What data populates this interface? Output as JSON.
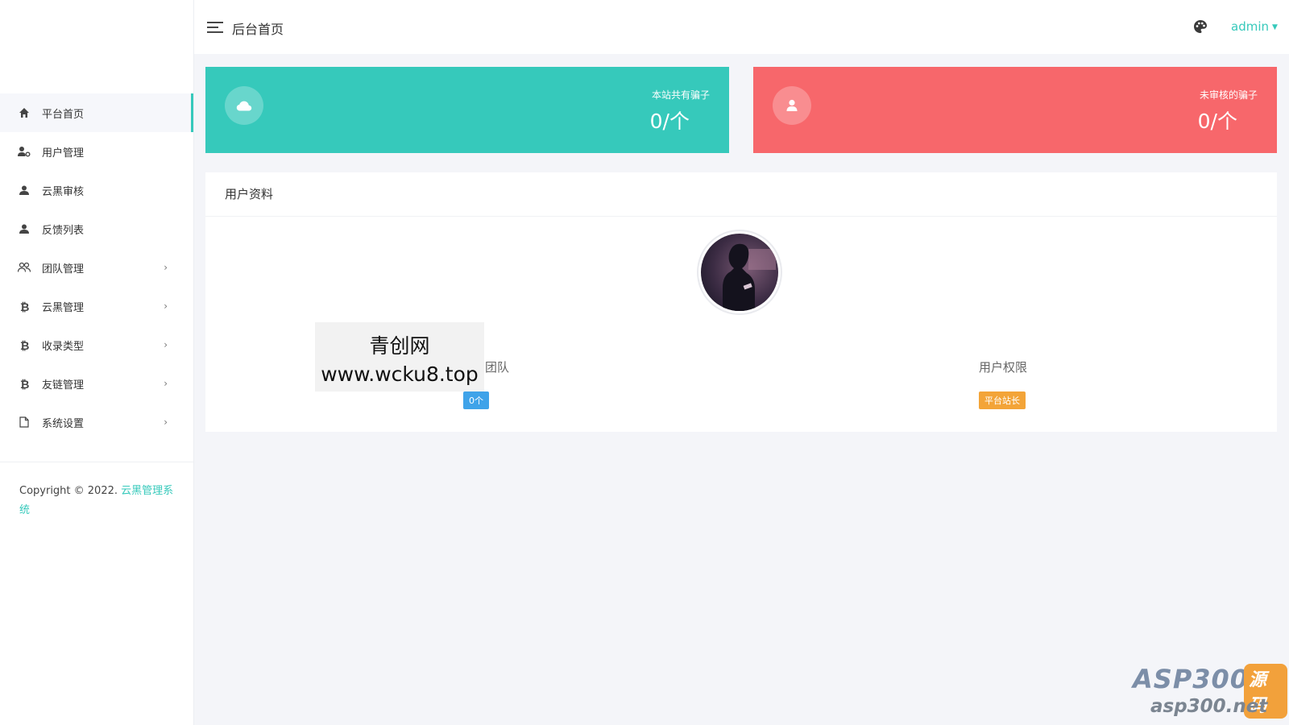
{
  "sidebar": {
    "items": [
      {
        "label": "平台首页",
        "icon": "home-icon",
        "active": true,
        "has_submenu": false
      },
      {
        "label": "用户管理",
        "icon": "user-settings-icon",
        "active": false,
        "has_submenu": false
      },
      {
        "label": "云黑审核",
        "icon": "user-icon",
        "active": false,
        "has_submenu": false
      },
      {
        "label": "反馈列表",
        "icon": "user-icon",
        "active": false,
        "has_submenu": false
      },
      {
        "label": "团队管理",
        "icon": "team-icon",
        "active": false,
        "has_submenu": true
      },
      {
        "label": "云黑管理",
        "icon": "bitcoin-icon",
        "active": false,
        "has_submenu": true
      },
      {
        "label": "收录类型",
        "icon": "bitcoin-icon",
        "active": false,
        "has_submenu": true
      },
      {
        "label": "友链管理",
        "icon": "bitcoin-icon",
        "active": false,
        "has_submenu": true
      },
      {
        "label": "系统设置",
        "icon": "file-icon",
        "active": false,
        "has_submenu": true
      }
    ],
    "submenu_arrow": "›",
    "copyright_prefix": "Copyright © 2022.",
    "copyright_link": "云黑管理系统"
  },
  "header": {
    "title": "后台首页",
    "user": "admin"
  },
  "stats": [
    {
      "label": "本站共有骗子",
      "value": "0/个",
      "color": "#36c9bb",
      "icon": "cloud-icon"
    },
    {
      "label": "未审核的骗子",
      "value": "0/个",
      "color": "#f7676b",
      "icon": "user-icon"
    }
  ],
  "profile": {
    "title": "用户资料",
    "team_label": "团队",
    "team_badge": "0个",
    "permission_label": "用户权限",
    "permission_badge": "平台站长"
  },
  "overlay": {
    "line1": "青创网",
    "line2": "www.wcku8.top"
  },
  "watermark": {
    "brand": "ASP300",
    "badge": "源码",
    "domain": "asp300.net"
  },
  "colors": {
    "accent": "#36c9bb",
    "danger": "#f7676b",
    "info": "#3fa3e9",
    "warning": "#f3a438"
  }
}
